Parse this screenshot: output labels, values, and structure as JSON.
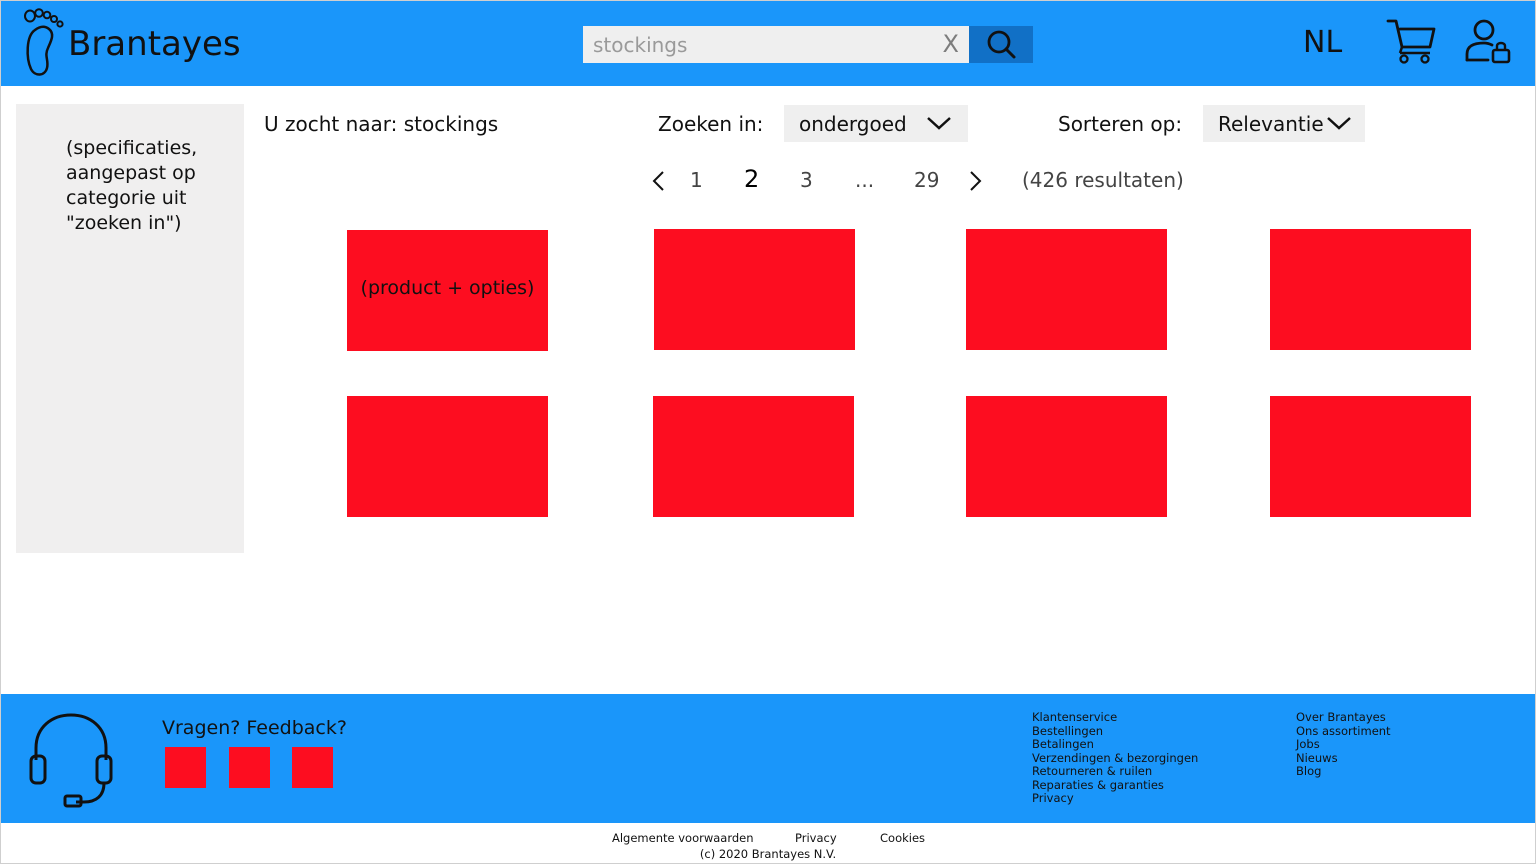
{
  "header": {
    "brand": "Brantayes",
    "search_value": "stockings",
    "clear_label": "X",
    "language": "NL",
    "icons": [
      "footprint-logo-icon",
      "search-icon",
      "cart-icon",
      "user-lock-icon"
    ]
  },
  "sidebar": {
    "text": "(specificaties,\naangepast op\ncategorie uit\n\"zoeken in\")"
  },
  "search_bar": {
    "query_text": "U zocht naar: stockings",
    "search_in_label": "Zoeken in:",
    "search_in_value": "ondergoed",
    "sort_label": "Sorteren op:",
    "sort_value": "Relevantie"
  },
  "pagination": {
    "pages": [
      "1",
      "2",
      "3",
      "...",
      "29"
    ],
    "current": "2",
    "results": "(426 resultaten)"
  },
  "products": {
    "first_label": "(product + opties)",
    "count": 8,
    "color": "#fd0d20"
  },
  "footer": {
    "feedback_title": "Vragen? Feedback?",
    "links_col1": [
      "Klantenservice",
      "Bestellingen",
      "Betalingen",
      "Verzendingen & bezorgingen",
      "Retourneren & ruilen",
      "Reparaties & garanties",
      "Privacy"
    ],
    "links_col2": [
      "Over Brantayes",
      "Ons assortiment",
      "Jobs",
      "Nieuws",
      "Blog"
    ],
    "legal": [
      "Algemente voorwaarden",
      "Privacy",
      "Cookies"
    ],
    "copyright": "(c) 2020 Brantayes N.V."
  },
  "colors": {
    "header_blue": "#1a96fa",
    "search_button": "#1170c6",
    "panel_gray": "#f0efef",
    "product_red": "#fd0d20"
  }
}
